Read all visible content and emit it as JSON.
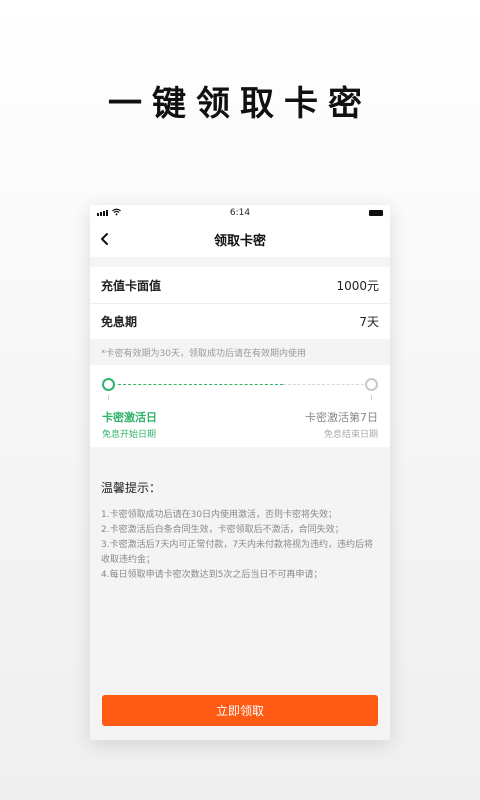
{
  "hero": {
    "title": "一键领取卡密"
  },
  "status_bar": {
    "time": "6:14"
  },
  "nav": {
    "title": "领取卡密"
  },
  "rows": [
    {
      "label": "充值卡面值",
      "value": "1000元"
    },
    {
      "label": "免息期",
      "value": "7天"
    }
  ],
  "note": "*卡密有效期为30天，领取成功后请在有效期内使用",
  "timeline": {
    "progress": 0.67,
    "start": {
      "title": "卡密激活日",
      "sub": "免息开始日期"
    },
    "end": {
      "title": "卡密激活第7日",
      "sub": "免息结束日期"
    }
  },
  "tips": {
    "title": "温馨提示：",
    "items": [
      "1.卡密领取成功后请在30日内使用激活，否则卡密将失效；",
      "2.卡密激活后白条合同生效，卡密领取后不激活，合同失效；",
      "3.卡密激活后7天内可正常付款，7天内未付款将视为违约，违约后将收取违约金；",
      "4.每日领取申请卡密次数达到5次之后当日不可再申请；"
    ]
  },
  "button": {
    "label": "立即领取"
  },
  "colors": {
    "accent": "#ff5a14",
    "green": "#2fb36a"
  }
}
